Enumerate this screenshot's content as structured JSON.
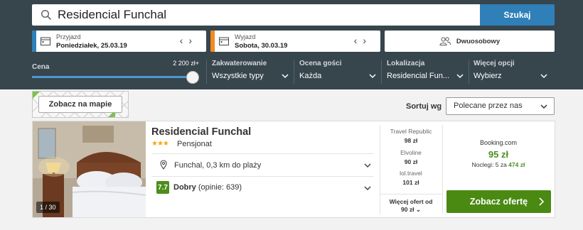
{
  "search": {
    "value": "Residencial Funchal",
    "button": "Szukaj"
  },
  "checkin": {
    "label": "Przyjazd",
    "value": "Poniedziałek, 25.03.19",
    "accent": "#2f7fb8"
  },
  "checkout": {
    "label": "Wyjazd",
    "value": "Sobota, 30.03.19",
    "accent": "#f18a21"
  },
  "room": {
    "label": "Dwuosobowy"
  },
  "filters": {
    "price": {
      "label": "Cena",
      "max": "2 200 zł+",
      "level": 1.0
    },
    "accommodation": {
      "label": "Zakwaterowanie",
      "value": "Wszystkie typy"
    },
    "guest_rating": {
      "label": "Ocena gości",
      "value": "Każda"
    },
    "location": {
      "label": "Lokalizacja",
      "value": "Residencial Fun..."
    },
    "more": {
      "label": "Więcej opcji",
      "value": "Wybierz"
    }
  },
  "map": {
    "button": "Zobacz na mapie"
  },
  "sort": {
    "label": "Sortuj wg",
    "value": "Polecane przez nas"
  },
  "result": {
    "photo_count": "1 / 30",
    "name": "Residencial Funchal",
    "stars": "★★★",
    "type": "Pensjonat",
    "location": "Funchal, 0,3 km do plaży",
    "rating": "7.7",
    "rating_word": "Dobry",
    "rating_count": "(opinie: 639)",
    "offers": [
      {
        "provider": "Travel Republic",
        "price": "98 zł"
      },
      {
        "provider": "Elvoline",
        "price": "90 zł"
      },
      {
        "provider": "lol.travel",
        "price": "101 zł"
      }
    ],
    "more_offers": "Więcej ofert od",
    "more_offers_price": "90 zł",
    "best": {
      "provider": "Booking.com",
      "price": "95 zł",
      "nights_label": "Noclegi: 5 za",
      "nights_total": "474 zł",
      "button": "Zobacz ofertę"
    }
  }
}
